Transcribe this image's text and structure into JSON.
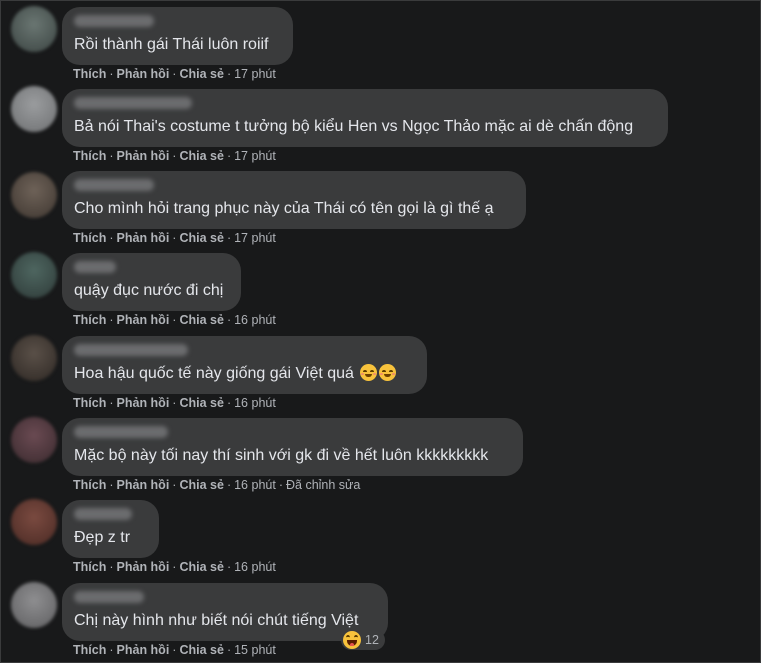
{
  "actions": {
    "like": "Thích",
    "reply": "Phản hồi",
    "share": "Chia sẻ",
    "separator": "·"
  },
  "comments": [
    {
      "text": "Rồi thành gái Thái luôn roiif",
      "time": "17 phút",
      "edited": ""
    },
    {
      "text": "Bả nói Thai's costume t tưởng bộ kiểu Hen vs Ngọc Thảo mặc ai dè chấn động",
      "time": "17 phút",
      "edited": ""
    },
    {
      "text": "Cho mình hỏi trang phục này của Thái có tên gọi là gì thế ạ",
      "time": "17 phút",
      "edited": ""
    },
    {
      "text": "quậy đục nước đi chị",
      "time": "16 phút",
      "edited": ""
    },
    {
      "text": "Hoa hậu quốc tế này giống gái Việt quá",
      "time": "16 phút",
      "edited": "",
      "emojis": [
        "grinning-blush-emoji",
        "grinning-blush-emoji"
      ]
    },
    {
      "text": "Mặc bộ này tối nay thí sinh với gk đi về hết luôn kkkkkkkkk",
      "time": "16 phút",
      "edited": "Đã chỉnh sửa"
    },
    {
      "text": "Đẹp z tr",
      "time": "16 phút",
      "edited": ""
    },
    {
      "text": "Chị này hình như biết nói chút tiếng Việt",
      "time": "15 phút",
      "edited": "",
      "reaction": {
        "icon": "haha-reaction-icon",
        "count": "12"
      }
    }
  ],
  "colors": {
    "background": "#18191a",
    "bubble": "#3a3b3c",
    "text": "#e4e6eb",
    "meta": "#b0b3b8"
  }
}
